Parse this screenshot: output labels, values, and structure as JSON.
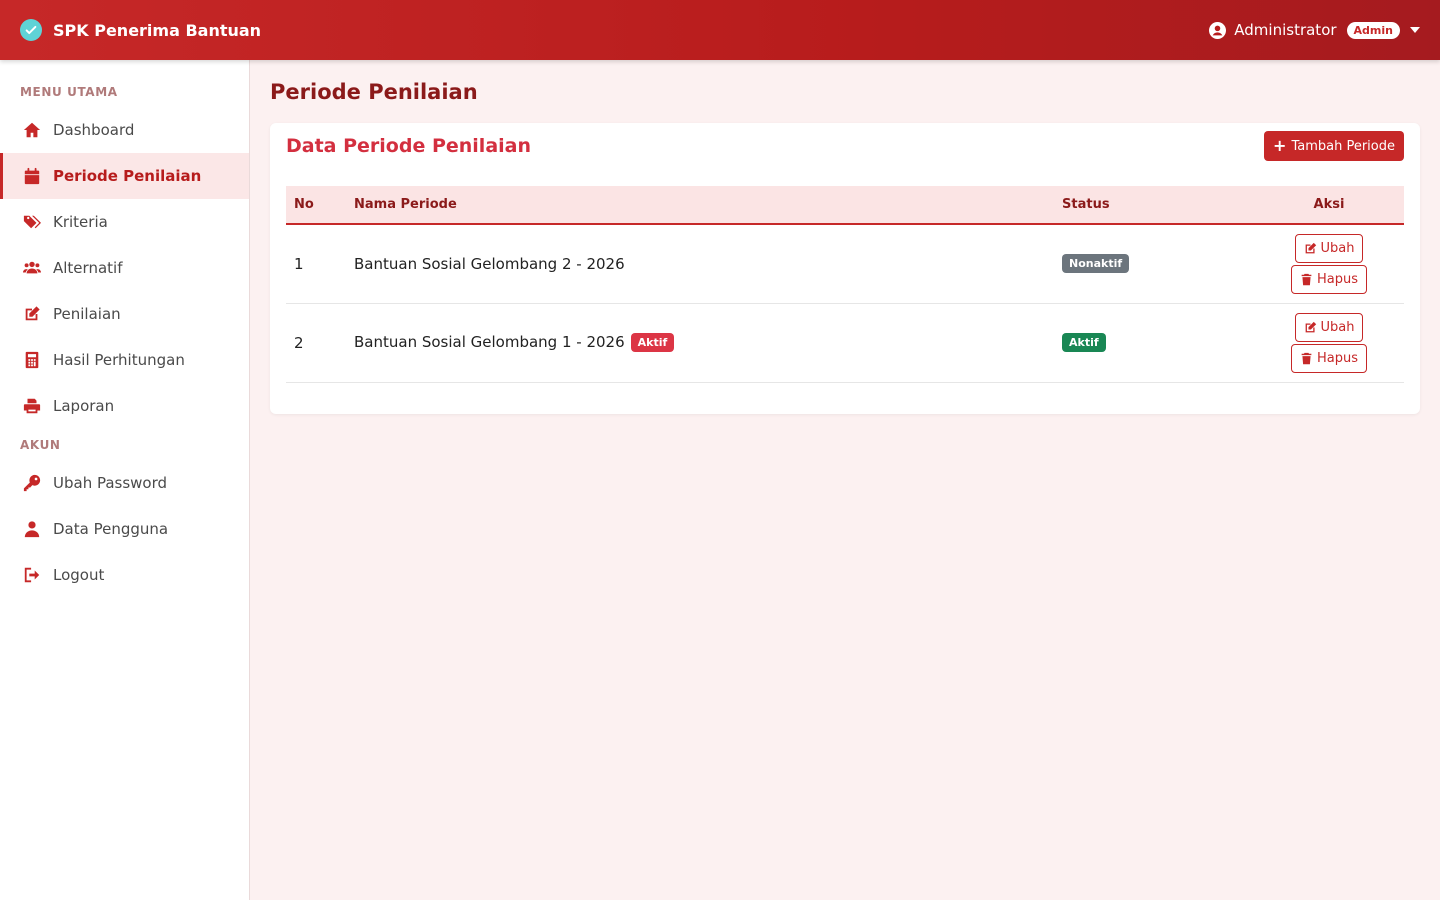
{
  "app": {
    "title": "SPK Penerima Bantuan"
  },
  "user": {
    "name": "Administrator",
    "role": "Admin"
  },
  "sidebar": {
    "sections": [
      {
        "title": "MENU UTAMA"
      },
      {
        "title": "AKUN"
      }
    ],
    "items": [
      {
        "label": "Dashboard",
        "icon": "home-icon"
      },
      {
        "label": "Periode Penilaian",
        "icon": "calendar-icon",
        "active": true
      },
      {
        "label": "Kriteria",
        "icon": "tags-icon"
      },
      {
        "label": "Alternatif",
        "icon": "users-icon"
      },
      {
        "label": "Penilaian",
        "icon": "edit-icon"
      },
      {
        "label": "Hasil Perhitungan",
        "icon": "calculator-icon"
      },
      {
        "label": "Laporan",
        "icon": "print-icon"
      },
      {
        "label": "Ubah Password",
        "icon": "key-icon"
      },
      {
        "label": "Data Pengguna",
        "icon": "user-icon"
      },
      {
        "label": "Logout",
        "icon": "logout-icon"
      }
    ]
  },
  "page": {
    "title": "Periode Penilaian"
  },
  "card": {
    "title": "Data Periode Penilaian",
    "add_button": "Tambah Periode"
  },
  "table": {
    "headers": {
      "no": "No",
      "nama": "Nama Periode",
      "status": "Status",
      "aksi": "Aksi"
    },
    "rows": [
      {
        "no": "1",
        "nama": "Bantuan Sosial Gelombang 2 - 2026",
        "inline_badge": "",
        "status": "Nonaktif",
        "edit": "Ubah",
        "delete": "Hapus"
      },
      {
        "no": "2",
        "nama": "Bantuan Sosial Gelombang 1 - 2026",
        "inline_badge": "Aktif",
        "status": "Aktif",
        "edit": "Ubah",
        "delete": "Hapus"
      }
    ]
  },
  "colors": {
    "primary": "#c62828",
    "accent_dark": "#8b1a1a",
    "status_inactive": "#6c757d",
    "status_active": "#198754",
    "badge_active": "#dc3545"
  }
}
